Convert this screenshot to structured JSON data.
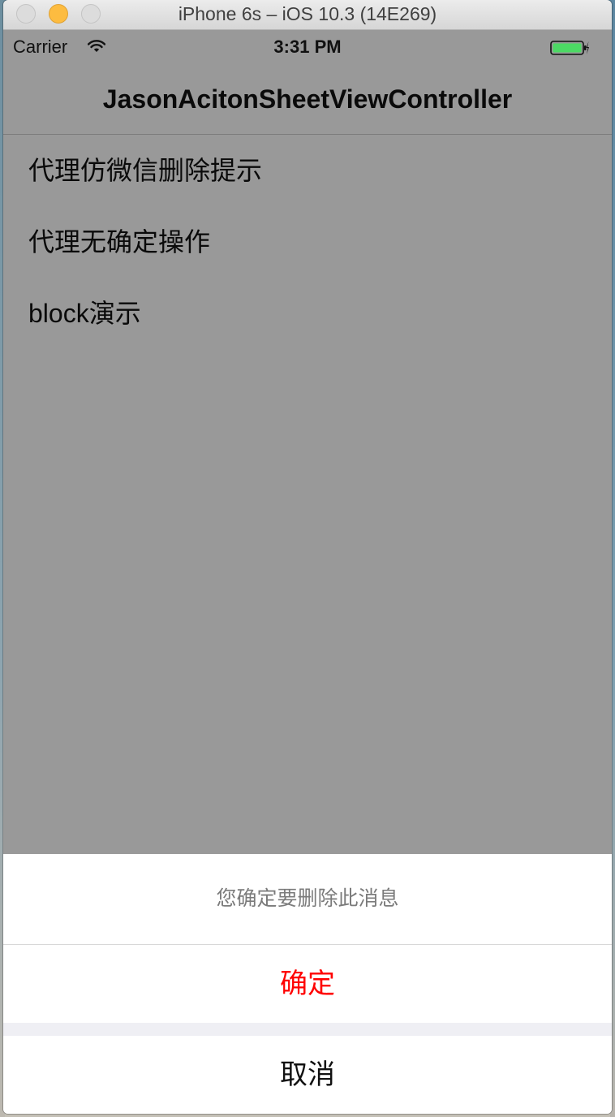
{
  "window": {
    "title": "iPhone 6s – iOS 10.3 (14E269)"
  },
  "statusbar": {
    "carrier": "Carrier",
    "time": "3:31 PM",
    "wifi_icon": "wifi-icon",
    "battery_icon": "battery-charging-icon",
    "battery_color": "#4cd964"
  },
  "navbar": {
    "title": "JasonAcitonSheetViewController"
  },
  "menu": {
    "items": [
      {
        "label": "代理仿微信删除提示"
      },
      {
        "label": "代理无确定操作"
      },
      {
        "label": "block演示"
      }
    ]
  },
  "action_sheet": {
    "message": "您确定要删除此消息",
    "confirm_label": "确定",
    "confirm_color": "#ff0000",
    "cancel_label": "取消"
  }
}
